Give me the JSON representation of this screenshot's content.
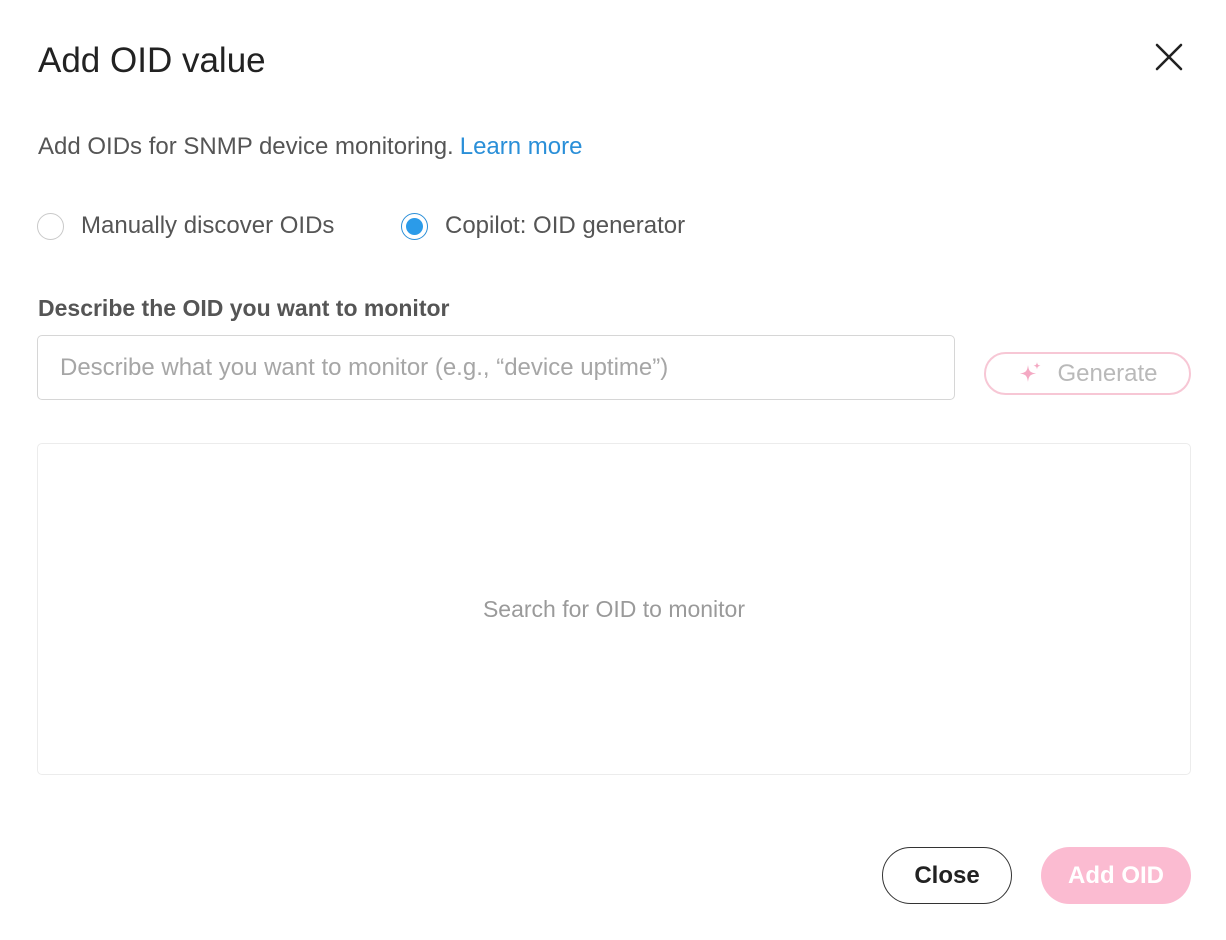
{
  "dialog": {
    "title": "Add OID value",
    "close_icon": "close-icon",
    "description": "Add OIDs for SNMP device monitoring.",
    "learn_more_label": "Learn more"
  },
  "mode": {
    "options": [
      {
        "label": "Manually discover OIDs",
        "selected": false
      },
      {
        "label": "Copilot: OID generator",
        "selected": true
      }
    ]
  },
  "describe": {
    "label": "Describe the OID you want to monitor",
    "input_value": "",
    "placeholder": "Describe what you want to monitor (e.g., “device uptime”)",
    "generate_label": "Generate",
    "generate_icon": "sparkle-icon",
    "generate_enabled": false
  },
  "results": {
    "empty_message": "Search for OID to monitor"
  },
  "footer": {
    "close_label": "Close",
    "add_label": "Add OID",
    "add_enabled": false
  },
  "colors": {
    "accent_blue": "#2b9be9",
    "link_blue": "#2a8fd8",
    "brand_pink": "#fbbbd1",
    "generate_border_pink": "#f7c7d5"
  }
}
